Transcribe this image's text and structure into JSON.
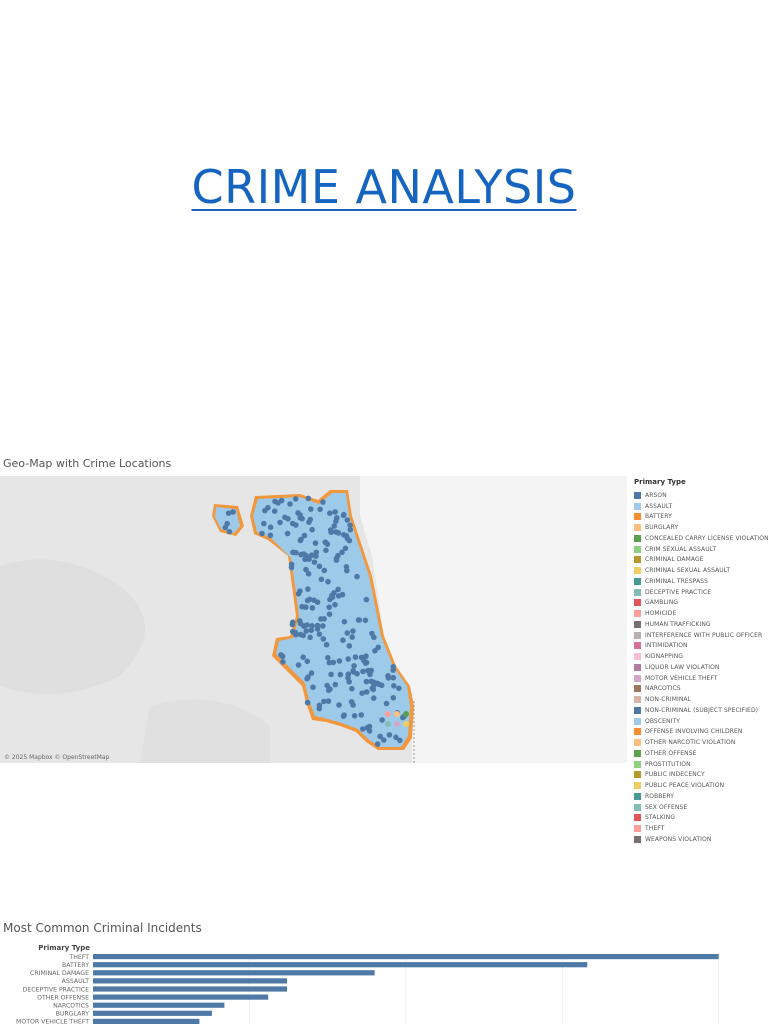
{
  "page": {
    "title": "CRIME ANALYSIS"
  },
  "map": {
    "title": "Geo-Map with Crime Locations",
    "attribution": "© 2025 Mapbox © OpenStreetMap",
    "land_color": "#e6e6e6",
    "water_color": "#f4f4f4",
    "region_color": "#9ecae9",
    "point_color": "#4e79a7",
    "edge_color": "#f28e2b"
  },
  "legend": {
    "title": "Primary Type",
    "items": [
      {
        "label": "ARSON",
        "color": "#4e79a7"
      },
      {
        "label": "ASSAULT",
        "color": "#a0cbe8"
      },
      {
        "label": "BATTERY",
        "color": "#f28e2b"
      },
      {
        "label": "BURGLARY",
        "color": "#ffbe7d"
      },
      {
        "label": "CONCEALED CARRY LICENSE VIOLATION",
        "color": "#59a14f"
      },
      {
        "label": "CRIM SEXUAL ASSAULT",
        "color": "#8cd17d"
      },
      {
        "label": "CRIMINAL DAMAGE",
        "color": "#b6992d"
      },
      {
        "label": "CRIMINAL SEXUAL ASSAULT",
        "color": "#f1ce63"
      },
      {
        "label": "CRIMINAL TRESPASS",
        "color": "#499894"
      },
      {
        "label": "DECEPTIVE PRACTICE",
        "color": "#86bcb6"
      },
      {
        "label": "GAMBLING",
        "color": "#e15759"
      },
      {
        "label": "HOMICIDE",
        "color": "#ff9d9a"
      },
      {
        "label": "HUMAN TRAFFICKING",
        "color": "#79706e"
      },
      {
        "label": "INTERFERENCE WITH PUBLIC OFFICER",
        "color": "#bab0ac"
      },
      {
        "label": "INTIMIDATION",
        "color": "#d37295"
      },
      {
        "label": "KIDNAPPING",
        "color": "#fabfd2"
      },
      {
        "label": "LIQUOR LAW VIOLATION",
        "color": "#b07aa1"
      },
      {
        "label": "MOTOR VEHICLE THEFT",
        "color": "#d4a6c8"
      },
      {
        "label": "NARCOTICS",
        "color": "#9d7660"
      },
      {
        "label": "NON-CRIMINAL",
        "color": "#d7b5a6"
      },
      {
        "label": "NON-CRIMINAL (SUBJECT SPECIFIED)",
        "color": "#4e79a7"
      },
      {
        "label": "OBSCENITY",
        "color": "#a0cbe8"
      },
      {
        "label": "OFFENSE INVOLVING CHILDREN",
        "color": "#f28e2b"
      },
      {
        "label": "OTHER NARCOTIC VIOLATION",
        "color": "#ffbe7d"
      },
      {
        "label": "OTHER OFFENSE",
        "color": "#59a14f"
      },
      {
        "label": "PROSTITUTION",
        "color": "#8cd17d"
      },
      {
        "label": "PUBLIC INDECENCY",
        "color": "#b6992d"
      },
      {
        "label": "PUBLIC PEACE VIOLATION",
        "color": "#f1ce63"
      },
      {
        "label": "ROBBERY",
        "color": "#499894"
      },
      {
        "label": "SEX OFFENSE",
        "color": "#86bcb6"
      },
      {
        "label": "STALKING",
        "color": "#e15759"
      },
      {
        "label": "THEFT",
        "color": "#ff9d9a"
      },
      {
        "label": "WEAPONS VIOLATION",
        "color": "#79706e"
      }
    ]
  },
  "chart_data": {
    "type": "bar",
    "orientation": "horizontal",
    "title": "Most Common Criminal Incidents",
    "ylabel": "Primary Type",
    "xlabel": "",
    "categories": [
      "THEFT",
      "BATTERY",
      "CRIMINAL DAMAGE",
      "ASSAULT",
      "DECEPTIVE PRACTICE",
      "OTHER OFFENSE",
      "NARCOTICS",
      "BURGLARY",
      "MOTOR VEHICLE THEFT"
    ],
    "values": [
      100,
      79,
      45,
      31,
      31,
      28,
      21,
      19,
      17
    ],
    "xlim": [
      0,
      105
    ],
    "bar_color": "#4e79a7",
    "grid": true
  }
}
